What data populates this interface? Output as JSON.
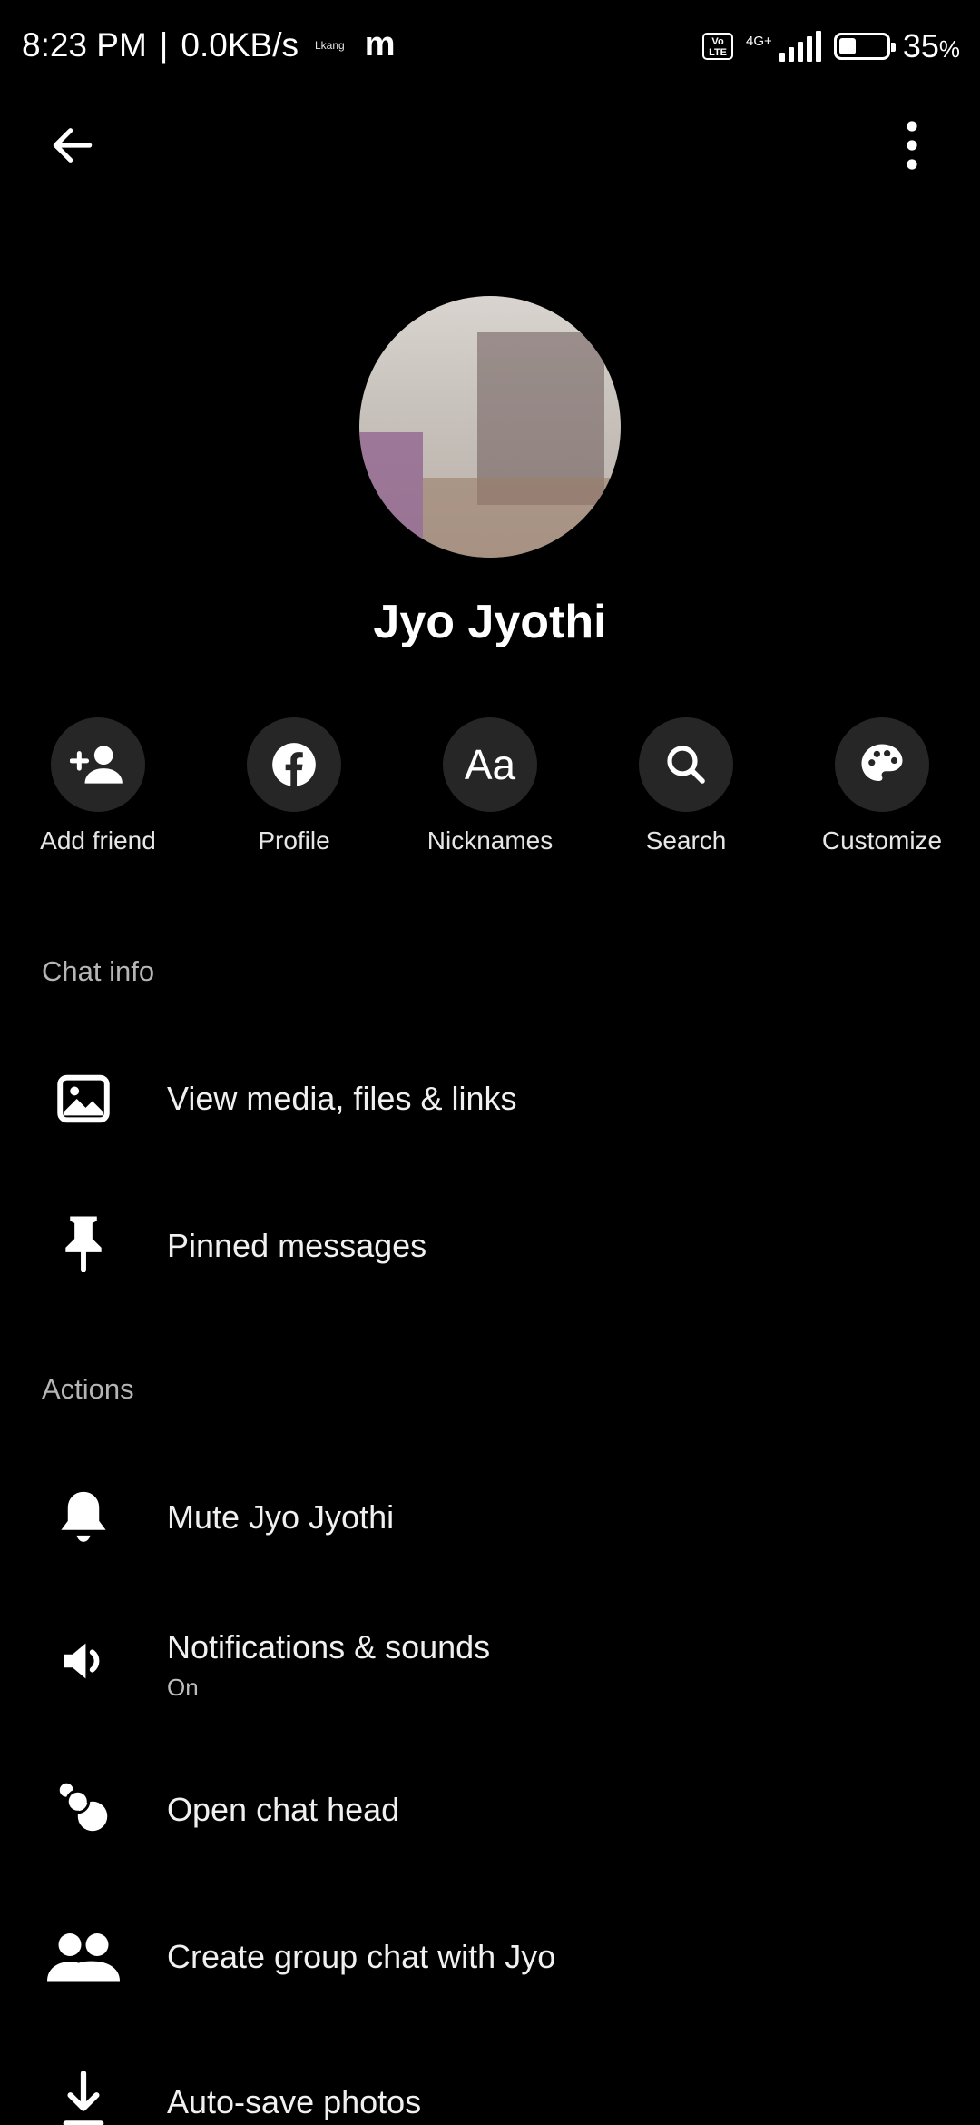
{
  "status_bar": {
    "time": "8:23 PM",
    "speed": "0.0KB/s",
    "small_tag": "Lkang",
    "app_logo": "m",
    "volte_label": "Vo LTE",
    "network_label": "4G+",
    "battery_percent": "35",
    "battery_unit": "%",
    "battery_level": 0.35
  },
  "app_bar": {
    "back_icon": "arrow-left-icon",
    "more_icon": "more-vertical-icon"
  },
  "profile": {
    "name": "Jyo Jyothi"
  },
  "actions": [
    {
      "label": "Add friend",
      "icon": "add-friend-icon"
    },
    {
      "label": "Profile",
      "icon": "facebook-icon"
    },
    {
      "label": "Nicknames",
      "icon": "aa-icon"
    },
    {
      "label": "Search",
      "icon": "search-icon"
    },
    {
      "label": "Customize",
      "icon": "palette-icon"
    }
  ],
  "chat_info": {
    "title": "Chat info",
    "items": [
      {
        "label": "View media, files & links",
        "icon": "image-icon"
      },
      {
        "label": "Pinned messages",
        "icon": "pin-icon"
      }
    ]
  },
  "actions_section": {
    "title": "Actions",
    "items": [
      {
        "label": "Mute Jyo Jyothi",
        "icon": "bell-icon"
      },
      {
        "label": "Notifications & sounds",
        "sub": "On",
        "icon": "speaker-icon"
      },
      {
        "label": "Open chat head",
        "icon": "chat-head-icon"
      },
      {
        "label": "Create group chat with Jyo",
        "icon": "people-icon"
      },
      {
        "label": "Auto-save photos",
        "icon": "download-icon"
      }
    ]
  },
  "colors": {
    "background": "#000000",
    "circle_bg": "#262626",
    "text_primary": "#f0f0f0",
    "text_secondary": "#b5b5b5"
  }
}
